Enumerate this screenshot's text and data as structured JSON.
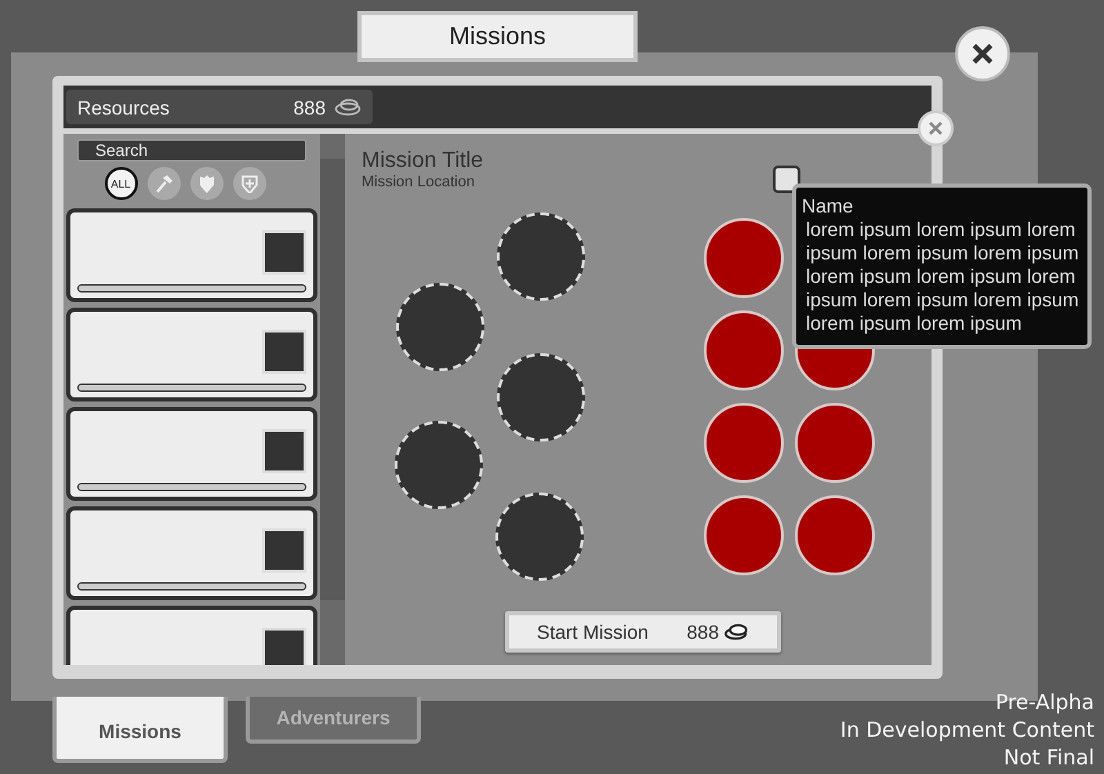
{
  "window": {
    "title": "Missions"
  },
  "resources": {
    "label": "Resources",
    "amount": "888"
  },
  "search": {
    "placeholder": "Search"
  },
  "filters": [
    {
      "kind": "all",
      "label": "ALL",
      "selected": true
    },
    {
      "kind": "hammer",
      "selected": false
    },
    {
      "kind": "badge",
      "selected": false
    },
    {
      "kind": "shield-plus",
      "selected": false
    }
  ],
  "mission": {
    "title": "Mission Title",
    "location": "Mission Location",
    "checked": false
  },
  "start_button": {
    "label": "Start Mission",
    "cost": "888"
  },
  "tooltip": {
    "title": "Name",
    "text": "lorem ipsum lorem ipsum lorem ipsum lorem ipsum lorem ipsum lorem ipsum lorem ipsum lorem ipsum lorem ipsum lorem ipsum lorem ipsum lorem ipsum"
  },
  "bottom_tabs": [
    {
      "label": "Missions",
      "selected": true
    },
    {
      "label": "Adventurers",
      "selected": false
    }
  ],
  "notice": [
    "Pre-Alpha",
    "In Development Content",
    "Not Final"
  ]
}
